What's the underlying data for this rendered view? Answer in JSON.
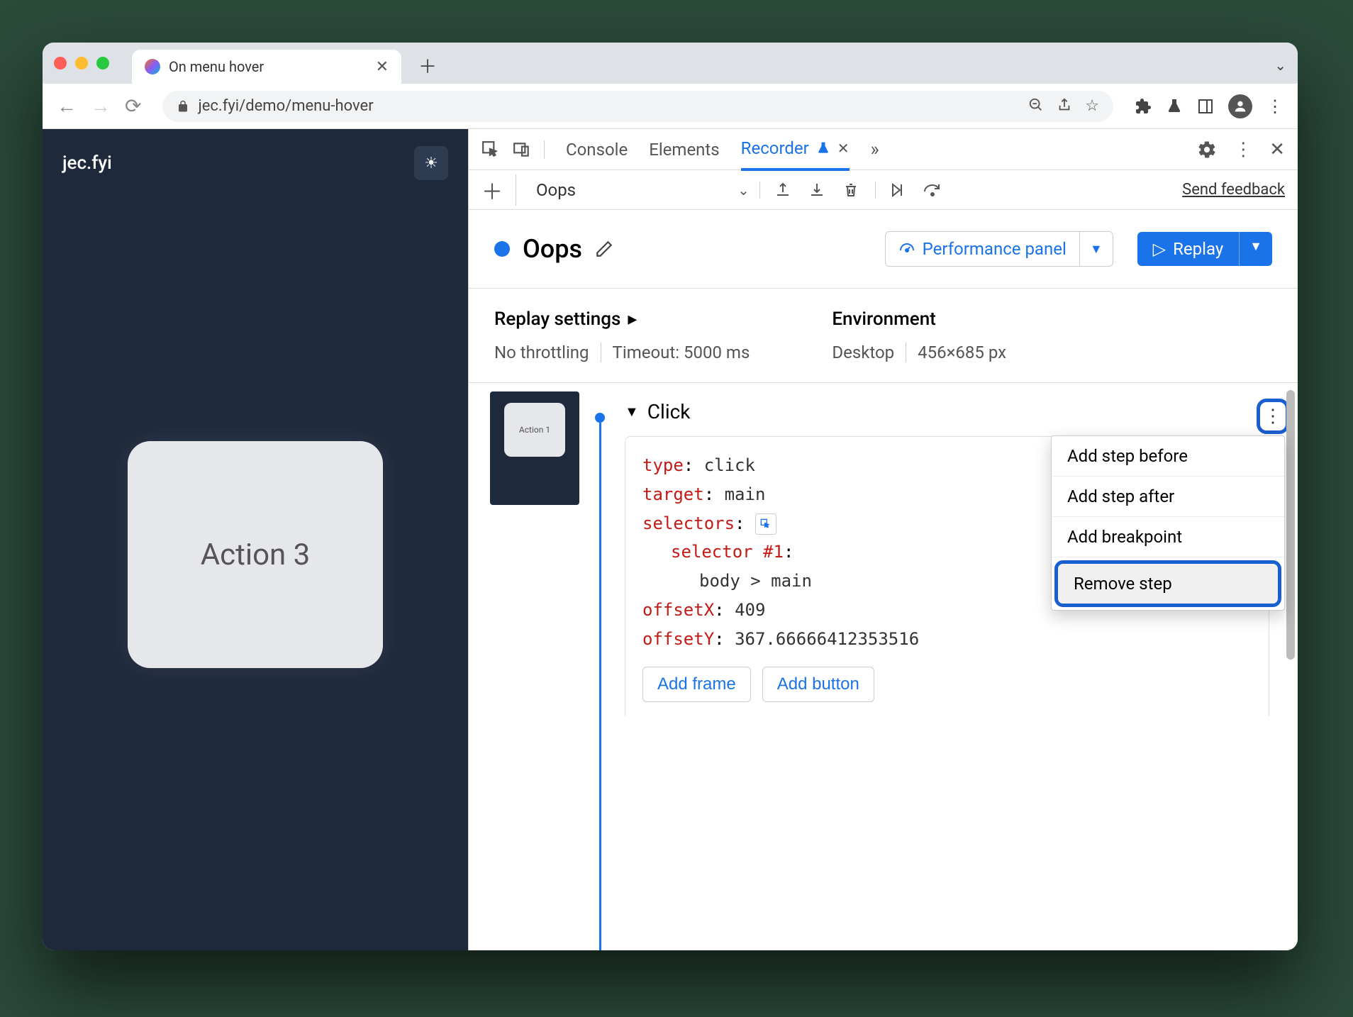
{
  "browser": {
    "tab_title": "On menu hover",
    "url": "jec.fyi/demo/menu-hover"
  },
  "page": {
    "site_title": "jec.fyi",
    "action_card": "Action 3"
  },
  "devtools": {
    "tabs": {
      "console": "Console",
      "elements": "Elements",
      "recorder": "Recorder"
    },
    "recorder": {
      "recording_name": "Oops",
      "send_feedback": "Send feedback",
      "title": "Oops",
      "perf_panel": "Performance panel",
      "replay": "Replay"
    },
    "settings": {
      "replay_heading": "Replay settings",
      "throttling": "No throttling",
      "timeout": "Timeout: 5000 ms",
      "env_heading": "Environment",
      "device": "Desktop",
      "size": "456×685 px"
    },
    "step": {
      "thumbnail_label": "Action 1",
      "name": "Click",
      "type_key": "type",
      "type_val": "click",
      "target_key": "target",
      "target_val": "main",
      "selectors_key": "selectors",
      "selector_label_key": "selector #1",
      "selector_val": "body > main",
      "offsetx_key": "offsetX",
      "offsetx_val": "409",
      "offsety_key": "offsetY",
      "offsety_val": "367.66666412353516",
      "add_frame": "Add frame",
      "add_button": "Add button"
    },
    "context_menu": {
      "add_before": "Add step before",
      "add_after": "Add step after",
      "add_breakpoint": "Add breakpoint",
      "remove": "Remove step"
    }
  }
}
